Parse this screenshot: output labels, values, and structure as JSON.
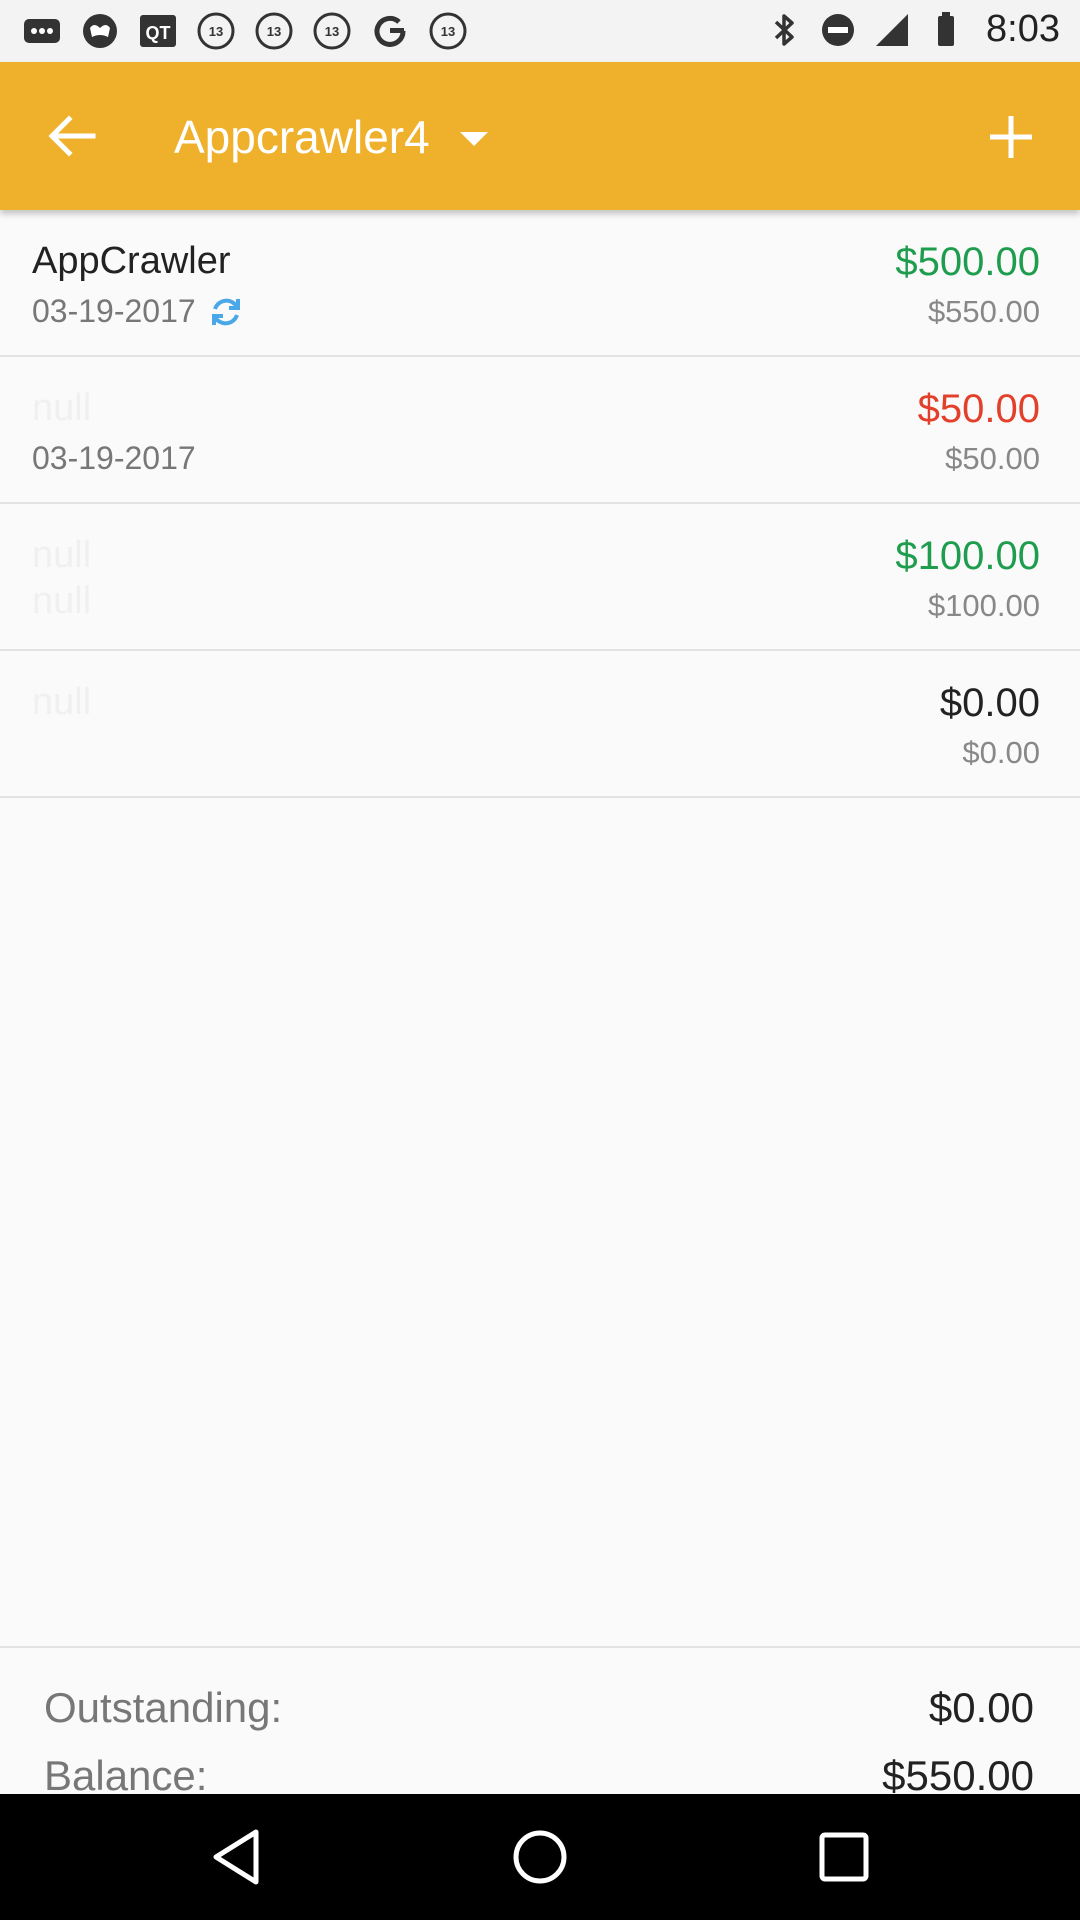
{
  "status_bar": {
    "time": "8:03",
    "icons": [
      "more-icon",
      "notification-icon",
      "qt-icon",
      "abc13-icon",
      "abc13-icon",
      "abc13-icon",
      "google-icon",
      "abc13-icon",
      "bluetooth-icon",
      "do-not-disturb-icon",
      "signal-icon",
      "battery-icon"
    ]
  },
  "toolbar": {
    "title": "Appcrawler4",
    "back_icon": "arrow-left-icon",
    "add_icon": "plus-icon"
  },
  "colors": {
    "toolbar": "#efb12c",
    "positive": "#1f9d4f",
    "negative": "#e2402a",
    "neutral": "#222222"
  },
  "rows": [
    {
      "name": "AppCrawler",
      "date": "03-19-2017",
      "amount": "$500.00",
      "amount_color": "#1f9d4f",
      "total": "$550.00",
      "synced": true
    },
    {
      "name": "null",
      "date": "03-19-2017",
      "amount": "$50.00",
      "amount_color": "#e2402a",
      "total": "$50.00"
    },
    {
      "name": "null",
      "sub": "null",
      "amount": "$100.00",
      "amount_color": "#1f9d4f",
      "total": "$100.00"
    },
    {
      "name": "null",
      "amount": "$0.00",
      "amount_color": "#222222",
      "total": "$0.00"
    }
  ],
  "summary": {
    "outstanding_label": "Outstanding:",
    "outstanding_value": "$0.00",
    "balance_label": "Balance:",
    "balance_value": "$550.00"
  }
}
